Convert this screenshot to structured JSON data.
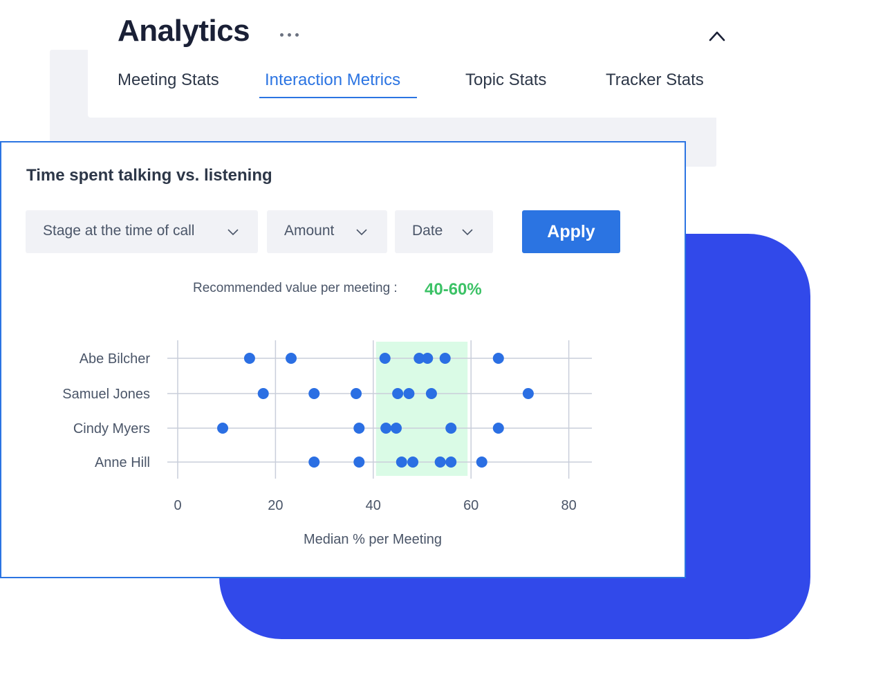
{
  "header": {
    "title": "Analytics",
    "more_icon": "more-horizontal-icon",
    "collapse_icon": "chevron-up-icon"
  },
  "tabs": [
    {
      "label": "Meeting Stats",
      "active": false
    },
    {
      "label": "Interaction Metrics",
      "active": true
    },
    {
      "label": "Topic Stats",
      "active": false
    },
    {
      "label": "Tracker Stats",
      "active": false
    }
  ],
  "card": {
    "title": "Time spent talking vs. listening",
    "filters": [
      {
        "label": "Stage at the time of call",
        "icon": "chevron-down-icon"
      },
      {
        "label": "Amount",
        "icon": "chevron-down-icon"
      },
      {
        "label": "Date",
        "icon": "chevron-down-icon"
      }
    ],
    "apply_label": "Apply",
    "recommendation_label": "Recommended value per meeting :",
    "recommendation_value": "40-60%"
  },
  "colors": {
    "accent": "#2b74e2",
    "point": "#2b6fe3",
    "band": "#dafbe6",
    "recommendation": "#3cc266",
    "decor_blue": "#3149ea",
    "panel_gray": "#f1f2f6"
  },
  "chart_data": {
    "type": "scatter",
    "title": "Time spent talking vs. listening",
    "xlabel": "Median % per Meeting",
    "ylabel": "",
    "xlim": [
      0,
      85
    ],
    "x_ticks": [
      0,
      20,
      40,
      60,
      80
    ],
    "grid": true,
    "highlight_band": {
      "from": 40,
      "to": 60,
      "label": "Recommended value per meeting"
    },
    "categories": [
      "Abe Bilcher",
      "Samuel Jones",
      "Cindy Myers",
      "Anne Hill"
    ],
    "series": [
      {
        "name": "Abe Bilcher",
        "values": [
          14.7,
          23.2,
          42.4,
          49.4,
          51.1,
          54.7,
          65.6
        ]
      },
      {
        "name": "Samuel Jones",
        "values": [
          17.5,
          27.9,
          36.5,
          45.0,
          47.3,
          51.9,
          71.7
        ]
      },
      {
        "name": "Cindy Myers",
        "values": [
          9.2,
          37.1,
          42.6,
          44.7,
          55.9,
          65.6
        ]
      },
      {
        "name": "Anne Hill",
        "values": [
          27.9,
          37.1,
          45.8,
          48.1,
          53.7,
          55.9,
          62.2
        ]
      }
    ]
  }
}
